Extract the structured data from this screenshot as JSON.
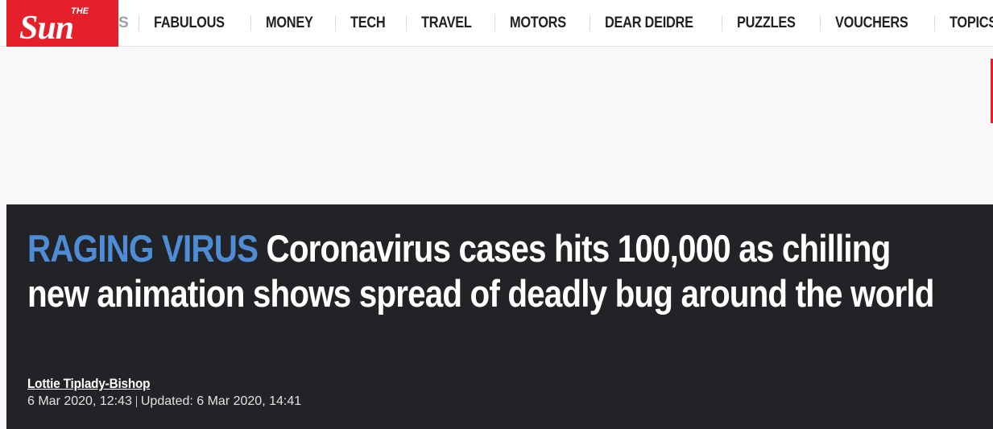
{
  "brand": {
    "logo_the": "THE",
    "logo_sun": "Sun",
    "logo_color": "#e6202a"
  },
  "nav": {
    "partial_item": "S",
    "items": [
      {
        "label": "FABULOUS"
      },
      {
        "label": "MONEY"
      },
      {
        "label": "TECH"
      },
      {
        "label": "TRAVEL"
      },
      {
        "label": "MOTORS"
      },
      {
        "label": "DEAR DEIDRE"
      },
      {
        "label": "PUZZLES"
      },
      {
        "label": "VOUCHERS"
      },
      {
        "label": "TOPICS A-Z"
      }
    ]
  },
  "article": {
    "kicker": "RAGING VIRUS",
    "headline": "Coronavirus cases hits 100,000 as chilling new animation shows spread of deadly bug around the world",
    "author": "Lottie Tiplady-Bishop",
    "published": "6 Mar 2020, 12:43",
    "updated": "Updated: 6 Mar 2020, 14:41",
    "kicker_color": "#4f8cd6",
    "background_color": "#222326"
  }
}
